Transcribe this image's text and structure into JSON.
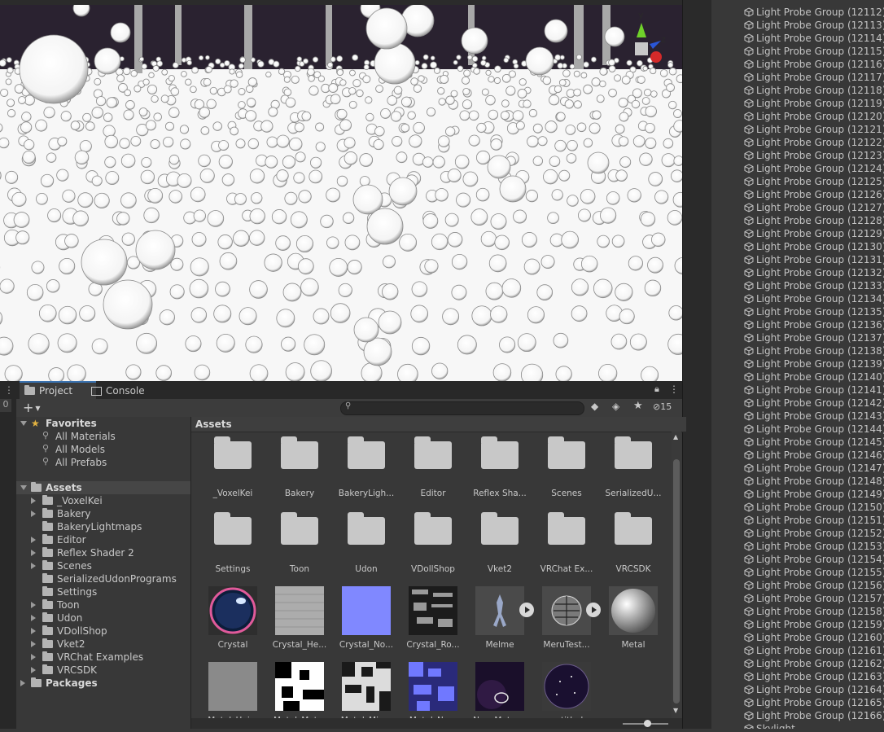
{
  "hierarchy": {
    "items": [
      "Light Probe Group (12112)",
      "Light Probe Group (12113)",
      "Light Probe Group (12114)",
      "Light Probe Group (12115)",
      "Light Probe Group (12116)",
      "Light Probe Group (12117)",
      "Light Probe Group (12118)",
      "Light Probe Group (12119)",
      "Light Probe Group (12120)",
      "Light Probe Group (12121)",
      "Light Probe Group (12122)",
      "Light Probe Group (12123)",
      "Light Probe Group (12124)",
      "Light Probe Group (12125)",
      "Light Probe Group (12126)",
      "Light Probe Group (12127)",
      "Light Probe Group (12128)",
      "Light Probe Group (12129)",
      "Light Probe Group (12130)",
      "Light Probe Group (12131)",
      "Light Probe Group (12132)",
      "Light Probe Group (12133)",
      "Light Probe Group (12134)",
      "Light Probe Group (12135)",
      "Light Probe Group (12136)",
      "Light Probe Group (12137)",
      "Light Probe Group (12138)",
      "Light Probe Group (12139)",
      "Light Probe Group (12140)",
      "Light Probe Group (12141)",
      "Light Probe Group (12142)",
      "Light Probe Group (12143)",
      "Light Probe Group (12144)",
      "Light Probe Group (12145)",
      "Light Probe Group (12146)",
      "Light Probe Group (12147)",
      "Light Probe Group (12148)",
      "Light Probe Group (12149)",
      "Light Probe Group (12150)",
      "Light Probe Group (12151)",
      "Light Probe Group (12152)",
      "Light Probe Group (12153)",
      "Light Probe Group (12154)",
      "Light Probe Group (12155)",
      "Light Probe Group (12156)",
      "Light Probe Group (12157)",
      "Light Probe Group (12158)",
      "Light Probe Group (12159)",
      "Light Probe Group (12160)",
      "Light Probe Group (12161)",
      "Light Probe Group (12162)",
      "Light Probe Group (12163)",
      "Light Probe Group (12164)",
      "Light Probe Group (12165)",
      "Light Probe Group (12166)",
      "Skylight"
    ]
  },
  "gizmo": {
    "y_label": "y",
    "z_label": "z"
  },
  "tabs": {
    "project": "Project",
    "console": "Console"
  },
  "toolbar": {
    "add_label": "+",
    "hidden_count": "15"
  },
  "tree": {
    "favorites_label": "Favorites",
    "favorites": [
      "All Materials",
      "All Models",
      "All Prefabs"
    ],
    "assets_label": "Assets",
    "assets_children": [
      {
        "name": "_VoxelKei",
        "arrow": true
      },
      {
        "name": "Bakery",
        "arrow": true
      },
      {
        "name": "BakeryLightmaps",
        "arrow": false
      },
      {
        "name": "Editor",
        "arrow": true
      },
      {
        "name": "Reflex Shader 2",
        "arrow": true
      },
      {
        "name": "Scenes",
        "arrow": true
      },
      {
        "name": "SerializedUdonPrograms",
        "arrow": false
      },
      {
        "name": "Settings",
        "arrow": false
      },
      {
        "name": "Toon",
        "arrow": true
      },
      {
        "name": "Udon",
        "arrow": true
      },
      {
        "name": "VDollShop",
        "arrow": true
      },
      {
        "name": "Vket2",
        "arrow": true
      },
      {
        "name": "VRChat Examples",
        "arrow": true
      },
      {
        "name": "VRCSDK",
        "arrow": true
      }
    ],
    "packages_label": "Packages"
  },
  "grid": {
    "header": "Assets",
    "items": [
      {
        "label": "_VoxelKei",
        "kind": "folder"
      },
      {
        "label": "Bakery",
        "kind": "folder"
      },
      {
        "label": "BakeryLigh...",
        "kind": "folder"
      },
      {
        "label": "Editor",
        "kind": "folder"
      },
      {
        "label": "Reflex Sha...",
        "kind": "folder"
      },
      {
        "label": "Scenes",
        "kind": "folder"
      },
      {
        "label": "SerializedU...",
        "kind": "folder"
      },
      {
        "label": "Settings",
        "kind": "folder"
      },
      {
        "label": "Toon",
        "kind": "folder"
      },
      {
        "label": "Udon",
        "kind": "folder"
      },
      {
        "label": "VDollShop",
        "kind": "folder"
      },
      {
        "label": "Vket2",
        "kind": "folder"
      },
      {
        "label": "VRChat Ex...",
        "kind": "folder"
      },
      {
        "label": "VRCSDK",
        "kind": "folder"
      },
      {
        "label": "Crystal",
        "kind": "crystal"
      },
      {
        "label": "Crystal_He...",
        "kind": "noise"
      },
      {
        "label": "Crystal_No...",
        "kind": "normal"
      },
      {
        "label": "Crystal_Ro...",
        "kind": "rough"
      },
      {
        "label": "Melme",
        "kind": "model"
      },
      {
        "label": "MeruTest...",
        "kind": "meru"
      },
      {
        "label": "Metal",
        "kind": "metal"
      },
      {
        "label": "Metal_Hei...",
        "kind": "grey"
      },
      {
        "label": "Metal_Met...",
        "kind": "bw"
      },
      {
        "label": "Metal_Mix...",
        "kind": "bw2"
      },
      {
        "label": "Metal_No...",
        "kind": "bluebw"
      },
      {
        "label": "New Mater...",
        "kind": "space"
      },
      {
        "label": "untitled",
        "kind": "sphere-space"
      }
    ]
  },
  "colors": {
    "accent": "#3a72b0",
    "favorite_star": "#e3b341",
    "panel_bg": "#383838"
  }
}
